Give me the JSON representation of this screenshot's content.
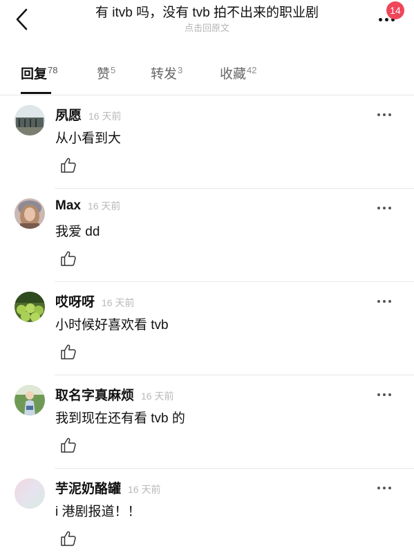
{
  "header": {
    "back_icon": "chevron-left-icon",
    "title": "有 itvb 吗，没有 tvb 拍不出来的职业剧",
    "subtitle": "点击回原文",
    "more_icon": "more-horizontal-icon",
    "notification_count": "14",
    "badge_color": "#f0465a"
  },
  "tabs": [
    {
      "label": "回复",
      "count": "78",
      "active": true
    },
    {
      "label": "赞",
      "count": "5",
      "active": false
    },
    {
      "label": "转发",
      "count": "3",
      "active": false
    },
    {
      "label": "收藏",
      "count": "42",
      "active": false
    }
  ],
  "comments": [
    {
      "username": "夙愿",
      "time": "16 天前",
      "text": "从小看到大",
      "avatar": "landscape-avatar"
    },
    {
      "username": "Max",
      "time": "16 天前",
      "text": "我爱 dd",
      "avatar": "woman-avatar"
    },
    {
      "username": "哎呀呀",
      "time": "16 天前",
      "text": "小时候好喜欢看 tvb",
      "avatar": "fruit-avatar"
    },
    {
      "username": "取名字真麻烦",
      "time": "16 天前",
      "text": "我到现在还有看 tvb 的",
      "avatar": "child-avatar"
    },
    {
      "username": "芋泥奶酪罐",
      "time": "16 天前",
      "text": "i 港剧报道！！",
      "avatar": "pastel-avatar"
    }
  ]
}
